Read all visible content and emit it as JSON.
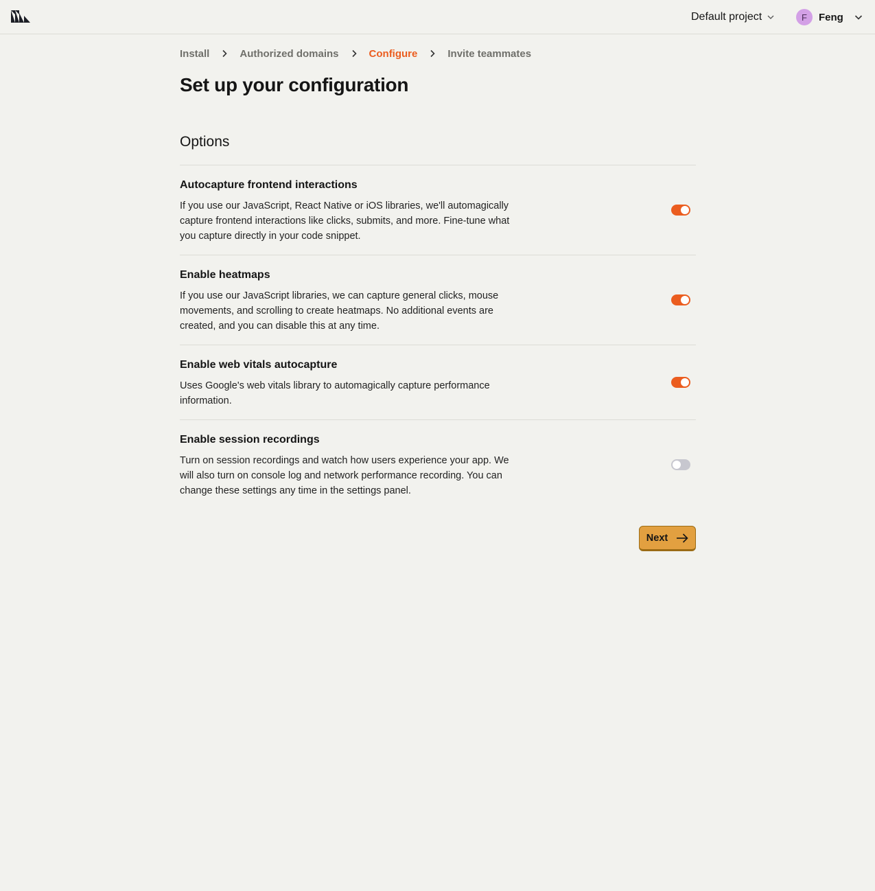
{
  "header": {
    "project_name": "Default project",
    "user": {
      "initial": "F",
      "name": "Feng",
      "avatar_color": "#d3a0e6"
    }
  },
  "breadcrumb": [
    {
      "label": "Install",
      "active": false
    },
    {
      "label": "Authorized domains",
      "active": false
    },
    {
      "label": "Configure",
      "active": true
    },
    {
      "label": "Invite teammates",
      "active": false
    }
  ],
  "page": {
    "title": "Set up your configuration",
    "section_title": "Options"
  },
  "options": [
    {
      "title": "Autocapture frontend interactions",
      "description": "If you use our JavaScript, React Native or iOS libraries, we'll automagically capture frontend interactions like clicks, submits, and more. Fine-tune what you capture directly in your code snippet.",
      "enabled": true
    },
    {
      "title": "Enable heatmaps",
      "description": "If you use our JavaScript libraries, we can capture general clicks, mouse movements, and scrolling to create heatmaps. No additional events are created, and you can disable this at any time.",
      "enabled": true
    },
    {
      "title": "Enable web vitals autocapture",
      "description": "Uses Google's web vitals library to automagically capture performance information.",
      "enabled": true
    },
    {
      "title": "Enable session recordings",
      "description": "Turn on session recordings and watch how users experience your app. We will also turn on console log and network performance recording. You can change these settings any time in the settings panel.",
      "enabled": false
    }
  ],
  "actions": {
    "next_label": "Next"
  },
  "colors": {
    "accent": "#eb5d1f",
    "toggle_off": "#c7c7cf",
    "next_button": "#e2a040",
    "background": "#f2f2ee"
  },
  "icons": {
    "logo": "posthog-logo-icon",
    "breadcrumb_separator": "chevron-right-icon",
    "dropdown": "chevron-down-icon",
    "next": "arrow-right-icon"
  }
}
